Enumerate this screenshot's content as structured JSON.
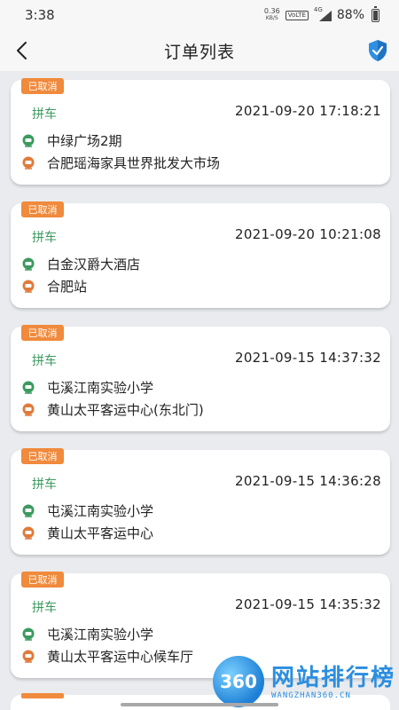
{
  "status_bar": {
    "time": "3:38",
    "net_speed": "0.36",
    "net_unit": "KB/S",
    "volte": "VoLTE",
    "network": "4G",
    "battery": "88%"
  },
  "header": {
    "title": "订单列表"
  },
  "colors": {
    "badge": "#f08a3c",
    "ride_type": "#3c9a5f",
    "start_icon": "#3c9a5f",
    "end_icon": "#e07b3a",
    "shield": "#2d8fe0"
  },
  "orders": [
    {
      "status": "已取消",
      "type": "拼车",
      "time": "2021-09-20 17:18:21",
      "start": "中绿广场2期",
      "end": "合肥瑶海家具世界批发大市场"
    },
    {
      "status": "已取消",
      "type": "拼车",
      "time": "2021-09-20 10:21:08",
      "start": "白金汉爵大酒店",
      "end": "合肥站"
    },
    {
      "status": "已取消",
      "type": "拼车",
      "time": "2021-09-15 14:37:32",
      "start": "屯溪江南实验小学",
      "end": "黄山太平客运中心(东北门)"
    },
    {
      "status": "已取消",
      "type": "拼车",
      "time": "2021-09-15 14:36:28",
      "start": "屯溪江南实验小学",
      "end": "黄山太平客运中心"
    },
    {
      "status": "已取消",
      "type": "拼车",
      "time": "2021-09-15 14:35:32",
      "start": "屯溪江南实验小学",
      "end": "黄山太平客运中心候车厅"
    }
  ],
  "watermark": {
    "logo": "360",
    "title": "网站排行榜",
    "subtitle": "WANGZHAN360.CN"
  }
}
